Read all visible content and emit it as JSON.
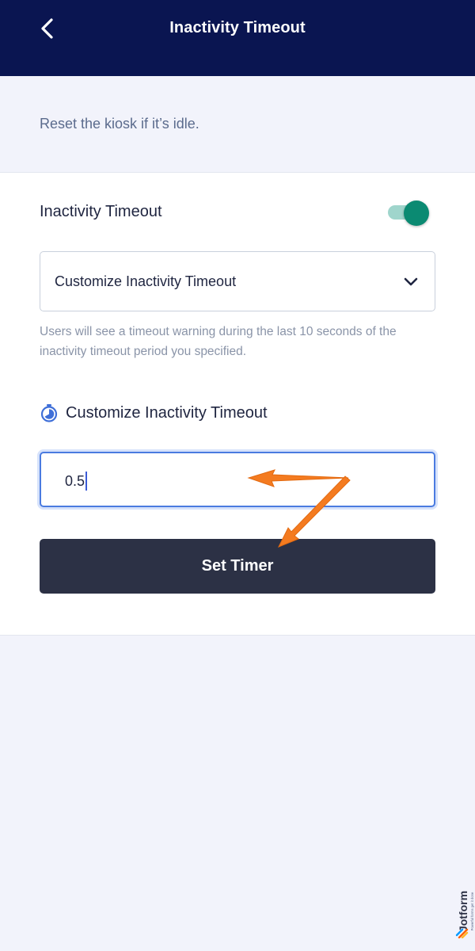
{
  "header": {
    "title": "Inactivity Timeout",
    "back_icon": "chevron-left-icon"
  },
  "description": "Reset the kiosk if it’s idle.",
  "settings": {
    "toggle_label": "Inactivity Timeout",
    "toggle_on": true,
    "toggle_color": "#0b8a72",
    "select_value": "Customize Inactivity Timeout",
    "hint": "Users will see a timeout warning during the last 10 seconds of the inactivity timeout period you specified.",
    "section_title": "Customize Inactivity Timeout",
    "section_icon": "stopwatch-icon",
    "input_value": "0.5",
    "button_label": "Set Timer"
  },
  "watermark": {
    "brand": "Jotform",
    "tagline": "Powerful forms get it done"
  },
  "colors": {
    "header_bg": "#0a1551",
    "button_bg": "#2c3145",
    "accent_arrow": "#f47b20",
    "input_focus": "#4a7be0"
  }
}
